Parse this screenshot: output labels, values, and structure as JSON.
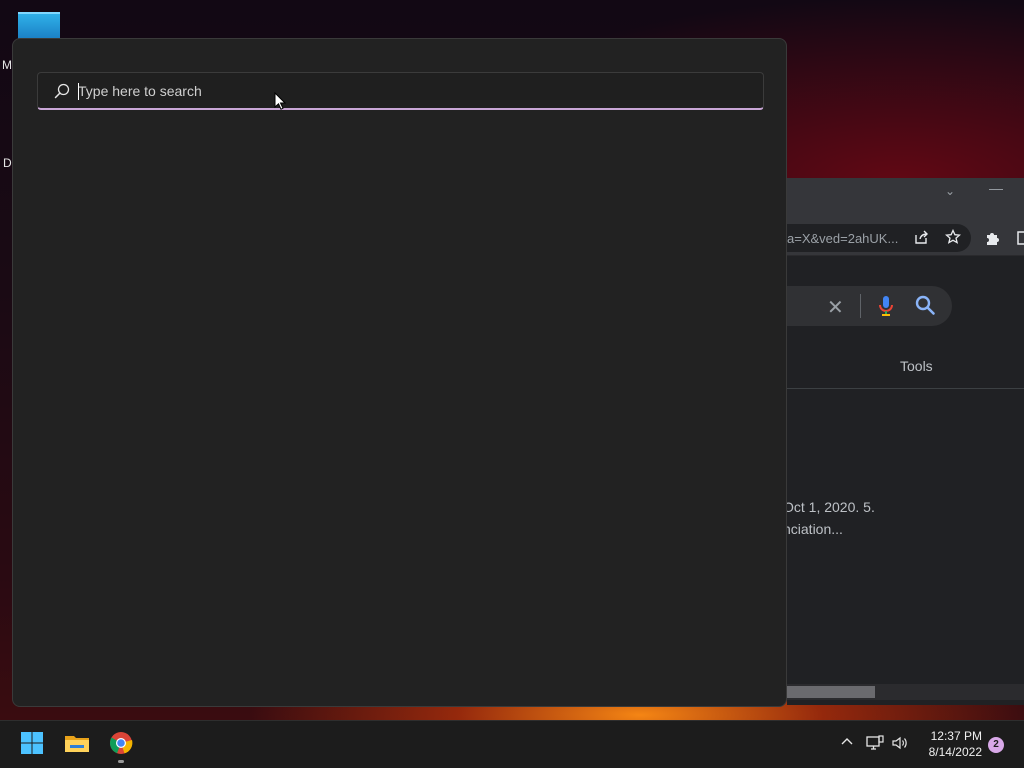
{
  "desktop": {
    "letter_1": "M",
    "letter_2": "Da"
  },
  "search": {
    "placeholder": "Type here to search",
    "value": ""
  },
  "chrome_background": {
    "url_fragment": "a=X&ved=2ahUK...",
    "tools_label": "Tools",
    "snippet_line_1": "Oct 1, 2020. 5.",
    "snippet_line_2": "nciation..."
  },
  "taskbar": {
    "apps": [
      {
        "icon": "windows-start-icon"
      },
      {
        "icon": "file-explorer-icon"
      },
      {
        "icon": "chrome-icon",
        "running": true
      }
    ],
    "tray": {
      "icons": [
        "chevron-up-icon",
        "network-icon",
        "volume-icon"
      ],
      "time": "12:37 PM",
      "date": "8/14/2022",
      "notifications": "2"
    }
  },
  "colors": {
    "panel_bg": "#222222",
    "search_accent": "#c9a6d6",
    "taskbar_bg": "#1c1c1c",
    "badge": "#d8a8e8"
  }
}
